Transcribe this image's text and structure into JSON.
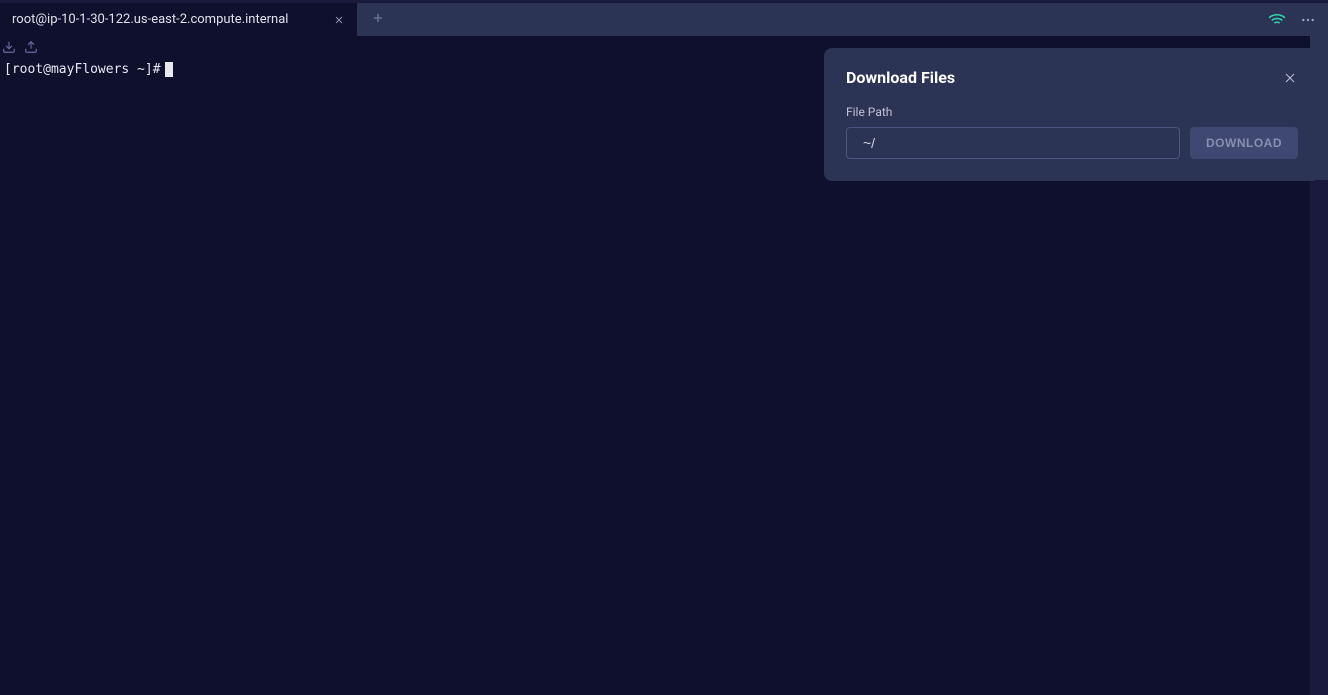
{
  "tabs": {
    "active": {
      "title": "root@ip-10-1-30-122.us-east-2.compute.internal"
    }
  },
  "terminal": {
    "prompt": "[root@mayFlowers ~]# "
  },
  "dialog": {
    "title": "Download Files",
    "label": "File Path",
    "input_value": "~/",
    "button_label": "DOWNLOAD"
  },
  "icons": {
    "close": "close-icon",
    "plus": "plus-icon",
    "wifi": "wifi-icon",
    "more": "more-horizontal-icon",
    "download": "download-icon",
    "upload": "upload-icon"
  }
}
